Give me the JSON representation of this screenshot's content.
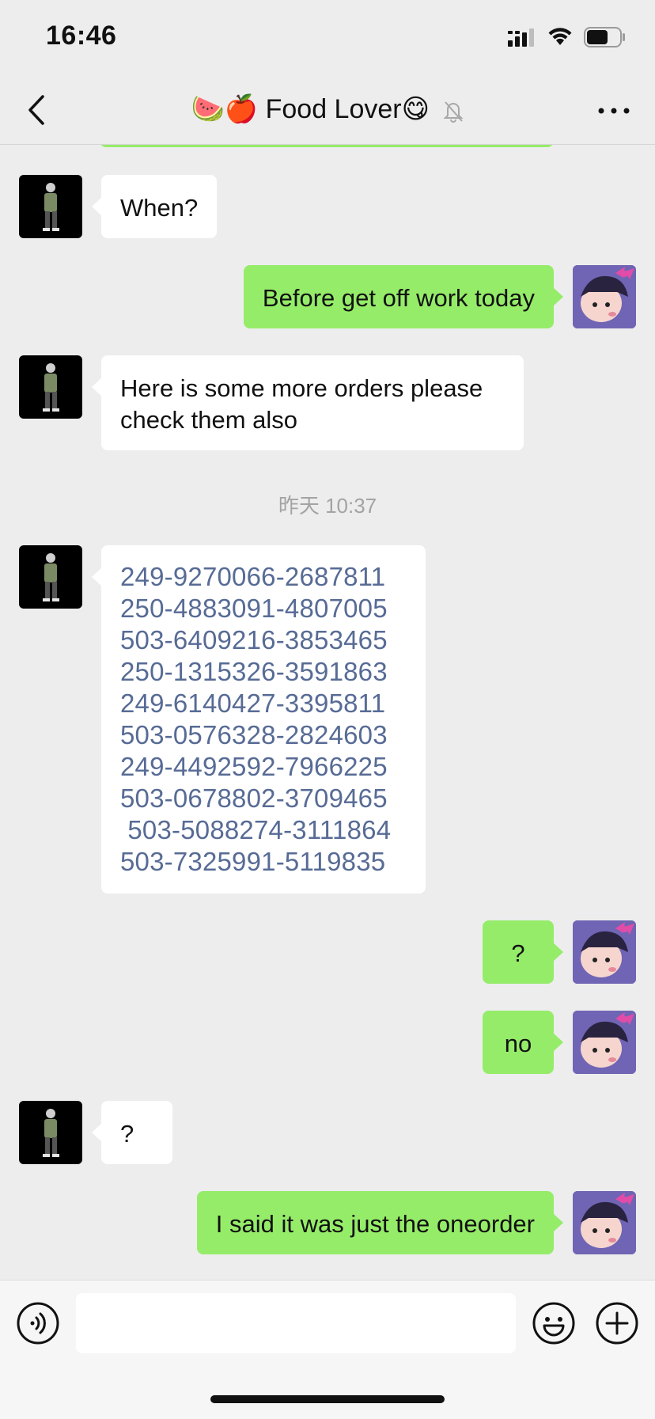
{
  "status_bar": {
    "time": "16:46",
    "icons": [
      "cellular-signal-icon",
      "wifi-icon",
      "battery-icon"
    ],
    "battery_level": 0.6
  },
  "header": {
    "title_emoji": "🍉🍎",
    "title": "Food Lover",
    "title_suffix_emoji": "😋",
    "back_icon": "chevron-left-icon",
    "mute_icon": "bell-muted-icon",
    "more_icon": "more-dots-icon"
  },
  "messages": [
    {
      "sender": "contact",
      "text": "When?"
    },
    {
      "sender": "me",
      "text": "Before get off work today"
    },
    {
      "sender": "contact",
      "lines": [
        "Here is some more orders please",
        "check them also"
      ]
    },
    {
      "type": "timestamp",
      "text": "昨天 10:37"
    },
    {
      "sender": "contact",
      "links": [
        "249-9270066-2687811",
        "250-4883091-4807005",
        "503-6409216-3853465",
        "250-1315326-3591863",
        "249-6140427-3395811",
        "503-0576328-2824603",
        "249-4492592-7966225",
        "503-0678802-3709465",
        " 503-5088274-3111864",
        "503-7325991-5119835"
      ]
    },
    {
      "sender": "me",
      "text": "?"
    },
    {
      "sender": "me",
      "text": "no"
    },
    {
      "sender": "contact",
      "text": "?"
    },
    {
      "sender": "me",
      "text": "I said it was just the oneorder"
    }
  ],
  "input_bar": {
    "placeholder": "",
    "voice_icon": "voice-icon",
    "emoji_icon": "emoji-icon",
    "plus_icon": "plus-icon"
  },
  "colors": {
    "background": "#ededed",
    "outgoing_bubble": "#95ec69",
    "incoming_bubble": "#ffffff",
    "link": "#576b95"
  }
}
